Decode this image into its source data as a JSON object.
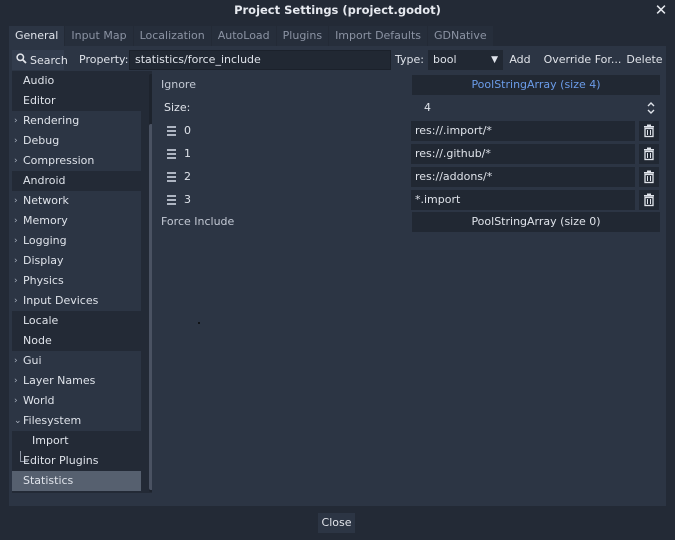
{
  "window": {
    "title": "Project Settings (project.godot)"
  },
  "tabs": [
    {
      "label": "General",
      "active": true
    },
    {
      "label": "Input Map"
    },
    {
      "label": "Localization"
    },
    {
      "label": "AutoLoad"
    },
    {
      "label": "Plugins"
    },
    {
      "label": "Import Defaults"
    },
    {
      "label": "GDNative"
    }
  ],
  "toolbar": {
    "search_label": "Search",
    "property_label": "Property:",
    "property_value": "statistics/force_include",
    "type_label": "Type:",
    "type_value": "bool",
    "add_label": "Add",
    "override_label": "Override For...",
    "delete_label": "Delete"
  },
  "tree": {
    "items": [
      {
        "label": "Audio",
        "expandable": false
      },
      {
        "label": "Editor",
        "expandable": false
      },
      {
        "label": "Rendering",
        "expandable": true
      },
      {
        "label": "Debug",
        "expandable": true
      },
      {
        "label": "Compression",
        "expandable": true
      },
      {
        "label": "Android",
        "expandable": false
      },
      {
        "label": "Network",
        "expandable": true
      },
      {
        "label": "Memory",
        "expandable": true
      },
      {
        "label": "Logging",
        "expandable": true
      },
      {
        "label": "Display",
        "expandable": true
      },
      {
        "label": "Physics",
        "expandable": true
      },
      {
        "label": "Input Devices",
        "expandable": true
      },
      {
        "label": "Locale",
        "expandable": false
      },
      {
        "label": "Node",
        "expandable": false
      },
      {
        "label": "Gui",
        "expandable": true
      },
      {
        "label": "Layer Names",
        "expandable": true
      },
      {
        "label": "World",
        "expandable": true
      },
      {
        "label": "Filesystem",
        "expandable": true,
        "expanded": true
      },
      {
        "label": "Import",
        "child": true
      },
      {
        "label": "Editor Plugins",
        "expandable": false
      },
      {
        "label": "Statistics",
        "selected": true
      }
    ]
  },
  "inspector": {
    "ignore_label": "Ignore",
    "ignore_value": "PoolStringArray (size 4)",
    "size_label": "Size:",
    "size_value": "4",
    "elements": [
      {
        "index": "0",
        "value": "res://.import/*"
      },
      {
        "index": "1",
        "value": "res://.github/*"
      },
      {
        "index": "2",
        "value": "res://addons/*"
      },
      {
        "index": "3",
        "value": "*.import"
      }
    ],
    "force_include_label": "Force Include",
    "force_include_value": "PoolStringArray (size 0)"
  },
  "footer": {
    "close_label": "Close"
  },
  "colors": {
    "accent": "#6b9ce9",
    "background": "#232a36",
    "panel": "#2c3544"
  },
  "icons": [
    "search-icon",
    "trash-icon",
    "drag-handle-icon",
    "spinner-updown-icon",
    "close-icon",
    "chevron-down-icon",
    "chevron-right-icon"
  ]
}
